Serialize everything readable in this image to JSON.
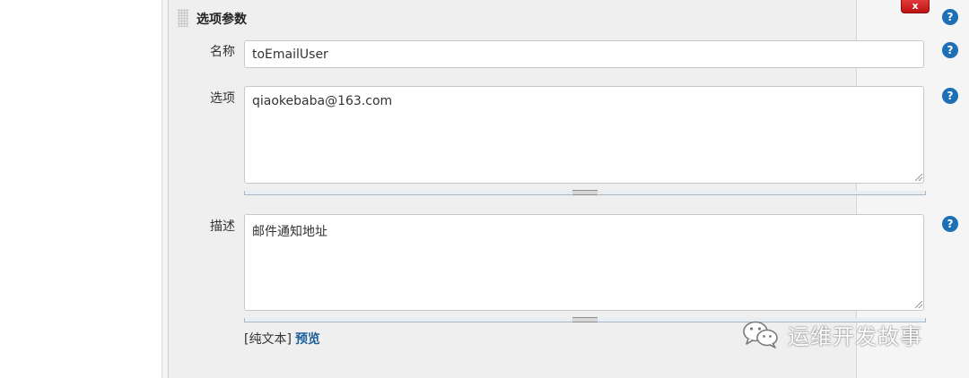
{
  "section": {
    "title": "选项参数"
  },
  "delete_label": "x",
  "help_glyph": "?",
  "fields": {
    "name": {
      "label": "名称",
      "value": "toEmailUser"
    },
    "choices": {
      "label": "选项",
      "value": "qiaokebaba@163.com"
    },
    "description": {
      "label": "描述",
      "value": "邮件通知地址"
    }
  },
  "format": {
    "plain_text": "[纯文本]",
    "preview": "预览"
  },
  "watermark": {
    "text": "运维开发故事"
  },
  "colors": {
    "help": "#1d6fb6",
    "delete": "#d42020",
    "link": "#1d5f9e"
  }
}
